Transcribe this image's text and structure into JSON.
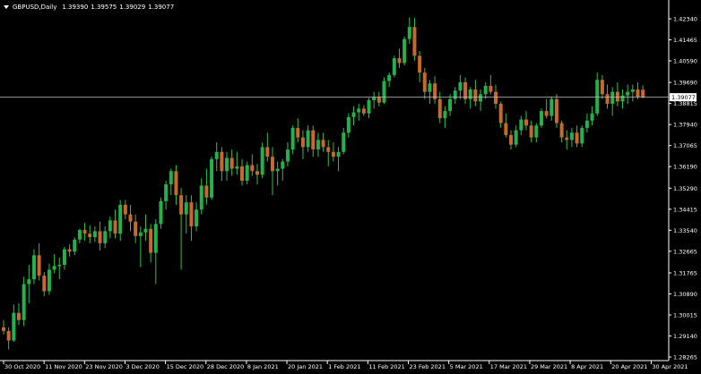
{
  "header": {
    "symbol_period": "GBPUSD,Daily",
    "quote": [
      "1.39390",
      "1.39575",
      "1.39029",
      "1.39077"
    ]
  },
  "colors": {
    "background": "#000000",
    "axis": "#ffffff",
    "bull": "#22b14c",
    "bear": "#c8682a",
    "wick": "#30c050",
    "last_price_line": "#c0c0c0",
    "last_price_label_bg": "#ffffff",
    "last_price_label_text": "#000000"
  },
  "chart_data": {
    "type": "candlestick",
    "symbol": "GBPUSD",
    "timeframe": "Daily",
    "grid": false,
    "y_ticks": [
      "1.42340",
      "1.41465",
      "1.40590",
      "1.39690",
      "1.38815",
      "1.37940",
      "1.37065",
      "1.36190",
      "1.35290",
      "1.34415",
      "1.33540",
      "1.32665",
      "1.31765",
      "1.30890",
      "1.30015",
      "1.29140",
      "1.28265"
    ],
    "y_range": [
      1.28265,
      1.4234
    ],
    "last_price": "1.39077",
    "x_labels": [
      "30 Oct 2020",
      "11 Nov 2020",
      "23 Nov 2020",
      "3 Dec 2020",
      "15 Dec 2020",
      "28 Dec 2020",
      "8 Jan 2021",
      "20 Jan 2021",
      "1 Feb 2021",
      "11 Feb 2021",
      "23 Feb 2021",
      "5 Mar 2021",
      "17 Mar 2021",
      "29 Mar 2021",
      "8 Apr 2021",
      "20 Apr 2021",
      "30 Apr 2021"
    ],
    "ohlc": [
      [
        1.295,
        1.298,
        1.292,
        1.2935
      ],
      [
        1.2935,
        1.295,
        1.2858,
        1.2895
      ],
      [
        1.2895,
        1.3045,
        1.289,
        1.301
      ],
      [
        1.301,
        1.305,
        1.296,
        1.298
      ],
      [
        1.298,
        1.316,
        1.2955,
        1.313
      ],
      [
        1.313,
        1.321,
        1.305,
        1.315
      ],
      [
        1.315,
        1.3275,
        1.313,
        1.325
      ],
      [
        1.325,
        1.33,
        1.3145,
        1.3165
      ],
      [
        1.3165,
        1.318,
        1.308,
        1.31
      ],
      [
        1.31,
        1.3215,
        1.3085,
        1.319
      ],
      [
        1.319,
        1.3255,
        1.3175,
        1.3205
      ],
      [
        1.3205,
        1.324,
        1.315,
        1.321
      ],
      [
        1.321,
        1.3285,
        1.319,
        1.3275
      ],
      [
        1.3275,
        1.3295,
        1.3245,
        1.3265
      ],
      [
        1.3265,
        1.3325,
        1.325,
        1.3315
      ],
      [
        1.3315,
        1.336,
        1.33,
        1.3355
      ],
      [
        1.3355,
        1.3385,
        1.331,
        1.334
      ],
      [
        1.334,
        1.3375,
        1.33,
        1.3325
      ],
      [
        1.3325,
        1.337,
        1.3305,
        1.335
      ],
      [
        1.335,
        1.339,
        1.327,
        1.33
      ],
      [
        1.33,
        1.337,
        1.328,
        1.335
      ],
      [
        1.335,
        1.341,
        1.332,
        1.3395
      ],
      [
        1.3395,
        1.344,
        1.332,
        1.334
      ],
      [
        1.334,
        1.348,
        1.331,
        1.346
      ],
      [
        1.346,
        1.348,
        1.34,
        1.342
      ],
      [
        1.342,
        1.346,
        1.335,
        1.339
      ],
      [
        1.339,
        1.342,
        1.33,
        1.333
      ],
      [
        1.333,
        1.337,
        1.32,
        1.3345
      ],
      [
        1.3345,
        1.342,
        1.331,
        1.336
      ],
      [
        1.336,
        1.338,
        1.322,
        1.326
      ],
      [
        1.326,
        1.34,
        1.313,
        1.338
      ],
      [
        1.338,
        1.349,
        1.336,
        1.3475
      ],
      [
        1.3475,
        1.356,
        1.344,
        1.3545
      ],
      [
        1.3545,
        1.361,
        1.35,
        1.36
      ],
      [
        1.36,
        1.3625,
        1.346,
        1.35
      ],
      [
        1.35,
        1.353,
        1.319,
        1.342
      ],
      [
        1.342,
        1.35,
        1.334,
        1.347
      ],
      [
        1.347,
        1.35,
        1.331,
        1.337
      ],
      [
        1.337,
        1.347,
        1.335,
        1.344
      ],
      [
        1.344,
        1.357,
        1.342,
        1.354
      ],
      [
        1.354,
        1.361,
        1.346,
        1.349
      ],
      [
        1.349,
        1.366,
        1.348,
        1.365
      ],
      [
        1.365,
        1.372,
        1.36,
        1.368
      ],
      [
        1.368,
        1.37,
        1.356,
        1.36
      ],
      [
        1.36,
        1.368,
        1.356,
        1.3655
      ],
      [
        1.3655,
        1.369,
        1.358,
        1.361
      ],
      [
        1.361,
        1.368,
        1.3585,
        1.362
      ],
      [
        1.362,
        1.365,
        1.354,
        1.356
      ],
      [
        1.356,
        1.364,
        1.3545,
        1.3625
      ],
      [
        1.3625,
        1.367,
        1.358,
        1.36
      ],
      [
        1.36,
        1.363,
        1.3545,
        1.3585
      ],
      [
        1.3585,
        1.372,
        1.357,
        1.37
      ],
      [
        1.37,
        1.376,
        1.364,
        1.366
      ],
      [
        1.366,
        1.37,
        1.35,
        1.36
      ],
      [
        1.36,
        1.364,
        1.354,
        1.361
      ],
      [
        1.361,
        1.365,
        1.356,
        1.364
      ],
      [
        1.364,
        1.372,
        1.362,
        1.369
      ],
      [
        1.369,
        1.379,
        1.367,
        1.378
      ],
      [
        1.378,
        1.382,
        1.372,
        1.374
      ],
      [
        1.374,
        1.377,
        1.365,
        1.37
      ],
      [
        1.37,
        1.379,
        1.368,
        1.377
      ],
      [
        1.377,
        1.379,
        1.366,
        1.369
      ],
      [
        1.369,
        1.376,
        1.366,
        1.373
      ],
      [
        1.373,
        1.376,
        1.368,
        1.37
      ],
      [
        1.37,
        1.373,
        1.362,
        1.368
      ],
      [
        1.368,
        1.372,
        1.364,
        1.366
      ],
      [
        1.366,
        1.37,
        1.36,
        1.368
      ],
      [
        1.368,
        1.378,
        1.367,
        1.376
      ],
      [
        1.376,
        1.384,
        1.374,
        1.3825
      ],
      [
        1.3825,
        1.387,
        1.379,
        1.3845
      ],
      [
        1.3845,
        1.388,
        1.381,
        1.386
      ],
      [
        1.386,
        1.3875,
        1.383,
        1.384
      ],
      [
        1.384,
        1.3905,
        1.382,
        1.3895
      ],
      [
        1.3895,
        1.393,
        1.386,
        1.391
      ],
      [
        1.391,
        1.393,
        1.387,
        1.3885
      ],
      [
        1.3885,
        1.399,
        1.388,
        1.3975
      ],
      [
        1.3975,
        1.401,
        1.395,
        1.4
      ],
      [
        1.4,
        1.408,
        1.399,
        1.407
      ],
      [
        1.407,
        1.411,
        1.403,
        1.405
      ],
      [
        1.405,
        1.416,
        1.404,
        1.415
      ],
      [
        1.415,
        1.424,
        1.413,
        1.42
      ],
      [
        1.42,
        1.4237,
        1.406,
        1.408
      ],
      [
        1.408,
        1.41,
        1.397,
        1.401
      ],
      [
        1.401,
        1.403,
        1.39,
        1.393
      ],
      [
        1.393,
        1.398,
        1.388,
        1.3965
      ],
      [
        1.3965,
        1.3995,
        1.388,
        1.39
      ],
      [
        1.39,
        1.393,
        1.38,
        1.382
      ],
      [
        1.382,
        1.387,
        1.378,
        1.385
      ],
      [
        1.385,
        1.392,
        1.383,
        1.39
      ],
      [
        1.39,
        1.395,
        1.388,
        1.3935
      ],
      [
        1.3935,
        1.4,
        1.39,
        1.397
      ],
      [
        1.397,
        1.399,
        1.388,
        1.39
      ],
      [
        1.39,
        1.395,
        1.386,
        1.394
      ],
      [
        1.394,
        1.398,
        1.387,
        1.389
      ],
      [
        1.389,
        1.394,
        1.385,
        1.392
      ],
      [
        1.392,
        1.397,
        1.39,
        1.3955
      ],
      [
        1.3955,
        1.4,
        1.392,
        1.393
      ],
      [
        1.393,
        1.396,
        1.386,
        1.388
      ],
      [
        1.388,
        1.389,
        1.378,
        1.38
      ],
      [
        1.38,
        1.384,
        1.374,
        1.375
      ],
      [
        1.375,
        1.377,
        1.369,
        1.371
      ],
      [
        1.371,
        1.379,
        1.37,
        1.377
      ],
      [
        1.377,
        1.383,
        1.375,
        1.3815
      ],
      [
        1.3815,
        1.385,
        1.377,
        1.379
      ],
      [
        1.379,
        1.381,
        1.372,
        1.374
      ],
      [
        1.374,
        1.38,
        1.372,
        1.379
      ],
      [
        1.379,
        1.386,
        1.378,
        1.385
      ],
      [
        1.385,
        1.39,
        1.382,
        1.383
      ],
      [
        1.383,
        1.391,
        1.381,
        1.39
      ],
      [
        1.39,
        1.392,
        1.378,
        1.38
      ],
      [
        1.38,
        1.381,
        1.372,
        1.374
      ],
      [
        1.374,
        1.377,
        1.369,
        1.373
      ],
      [
        1.373,
        1.378,
        1.37,
        1.376
      ],
      [
        1.376,
        1.379,
        1.37,
        1.3715
      ],
      [
        1.3715,
        1.379,
        1.37,
        1.378
      ],
      [
        1.378,
        1.384,
        1.376,
        1.381
      ],
      [
        1.381,
        1.387,
        1.379,
        1.384
      ],
      [
        1.384,
        1.401,
        1.383,
        1.398
      ],
      [
        1.398,
        1.4,
        1.39,
        1.392
      ],
      [
        1.392,
        1.396,
        1.386,
        1.388
      ],
      [
        1.388,
        1.395,
        1.383,
        1.393
      ],
      [
        1.393,
        1.397,
        1.387,
        1.389
      ],
      [
        1.389,
        1.394,
        1.386,
        1.3915
      ],
      [
        1.3915,
        1.396,
        1.388,
        1.393
      ],
      [
        1.393,
        1.396,
        1.389,
        1.394
      ],
      [
        1.394,
        1.397,
        1.39,
        1.391
      ],
      [
        1.3939,
        1.39575,
        1.39029,
        1.39077
      ]
    ]
  }
}
